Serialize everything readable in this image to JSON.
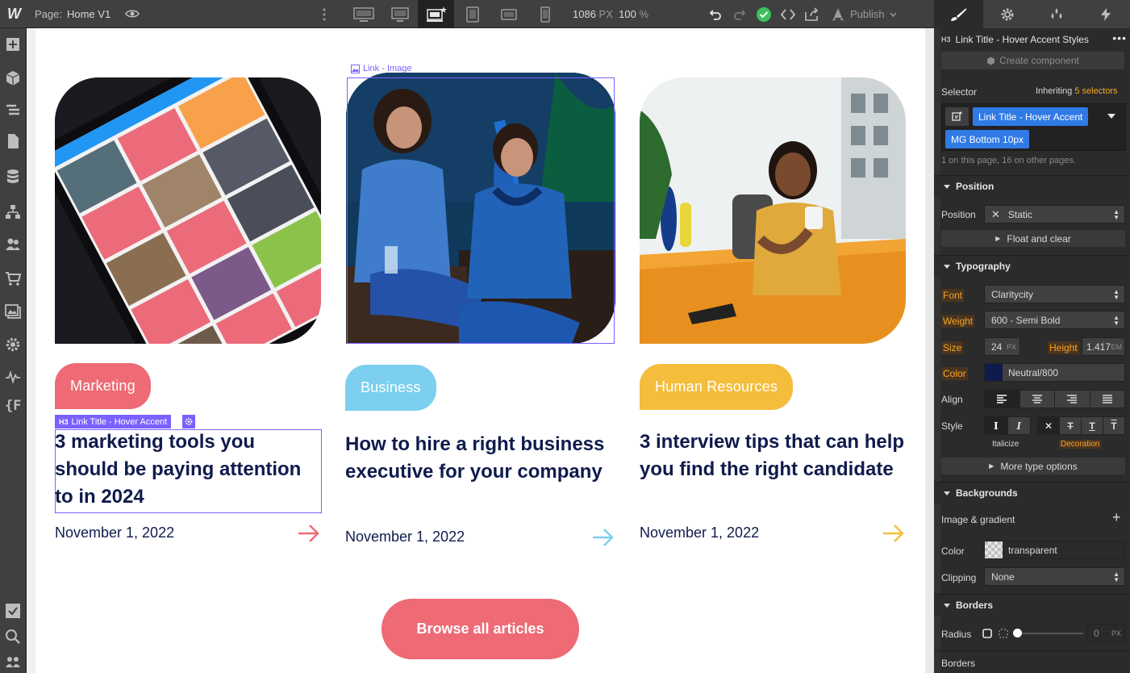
{
  "topbar": {
    "page_prefix": "Page:",
    "page_name": "Home V1",
    "width_value": "1086",
    "width_unit": "PX",
    "zoom_value": "100",
    "zoom_unit": "%",
    "publish_label": "Publish"
  },
  "canvas": {
    "cards": [
      {
        "tag": "Marketing",
        "title": "3 marketing tools you should be paying attention to in 2024",
        "date": "November 1, 2022"
      },
      {
        "tag": "Business",
        "title": "How to hire a right business executive for your company",
        "date": "November 1, 2022"
      },
      {
        "tag": "Human Resources",
        "title": "3 interview tips that can help you find the right candidate",
        "date": "November 1, 2022"
      }
    ],
    "browse_label": "Browse all articles",
    "image_selection_label": "Link - Image",
    "title_selection_label": "Link Title - Hover Accent",
    "colors": {
      "marketing": "#ee6a75",
      "business": "#7ccfee",
      "hr": "#f4bd3b",
      "text": "#0f1b4c",
      "selection": "#7b61ff"
    }
  },
  "rpanel": {
    "element_title": "Link Title - Hover Accent Styles",
    "create_component": "Create component",
    "selector_label": "Selector",
    "inheriting_prefix": "Inheriting",
    "inheriting_count": "5 selectors",
    "selector_chip_1": "Link Title - Hover Accent",
    "selector_chip_2": "MG Bottom 10px",
    "selector_note": "1 on this page, 16 on other pages.",
    "position": {
      "heading": "Position",
      "label": "Position",
      "value": "Static",
      "float_clear": "Float and clear"
    },
    "typography": {
      "heading": "Typography",
      "font_label": "Font",
      "font_value": "Claritycity",
      "weight_label": "Weight",
      "weight_value": "600 - Semi Bold",
      "size_label": "Size",
      "size_value": "24",
      "size_unit": "PX",
      "height_label": "Height",
      "height_value": "1.417",
      "height_unit": "EM",
      "color_label": "Color",
      "color_value": "Neutral/800",
      "align_label": "Align",
      "style_label": "Style",
      "italicize_label": "Italicize",
      "decoration_label": "Decoration",
      "more_options": "More type options"
    },
    "backgrounds": {
      "heading": "Backgrounds",
      "image_gradient": "Image & gradient",
      "color_label": "Color",
      "color_value": "transparent",
      "clipping_label": "Clipping",
      "clipping_value": "None"
    },
    "borders": {
      "heading": "Borders",
      "radius_label": "Radius",
      "radius_value": "0",
      "radius_unit": "PX",
      "borders_label": "Borders"
    }
  }
}
